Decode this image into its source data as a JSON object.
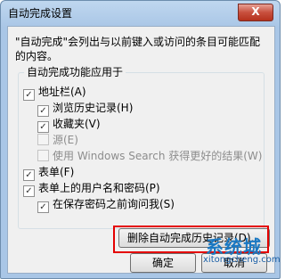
{
  "dialog": {
    "title": "自动完成设置",
    "close_label": "X",
    "description": "\"自动完成\"会列出与以前键入或访问的条目可能匹配的内容。",
    "group_label": "自动完成功能应用于",
    "options": [
      {
        "label": "地址栏(A)",
        "checked": true,
        "enabled": true
      },
      {
        "label": "浏览历史记录(H)",
        "checked": true,
        "enabled": true
      },
      {
        "label": "收藏夹(V)",
        "checked": true,
        "enabled": true
      },
      {
        "label": "源(E)",
        "checked": false,
        "enabled": false
      },
      {
        "label": "使用 Windows Search 获得更好的结果(W)",
        "checked": false,
        "enabled": false
      },
      {
        "label": "表单(F)",
        "checked": true,
        "enabled": true
      },
      {
        "label": "表单上的用户名和密码(P)",
        "checked": true,
        "enabled": true
      },
      {
        "label": "在保存密码之前询问我(S)",
        "checked": true,
        "enabled": true
      }
    ],
    "delete_history_button": "删除自动完成历史记录(D)...",
    "ok_button": "确定",
    "cancel_button": "取消"
  },
  "watermark": {
    "text": "系统城",
    "url": "xitongcheng.com"
  },
  "colors": {
    "highlight": "#e40000",
    "title_bar": "#bfd7ef",
    "close_button": "#c8503e"
  }
}
